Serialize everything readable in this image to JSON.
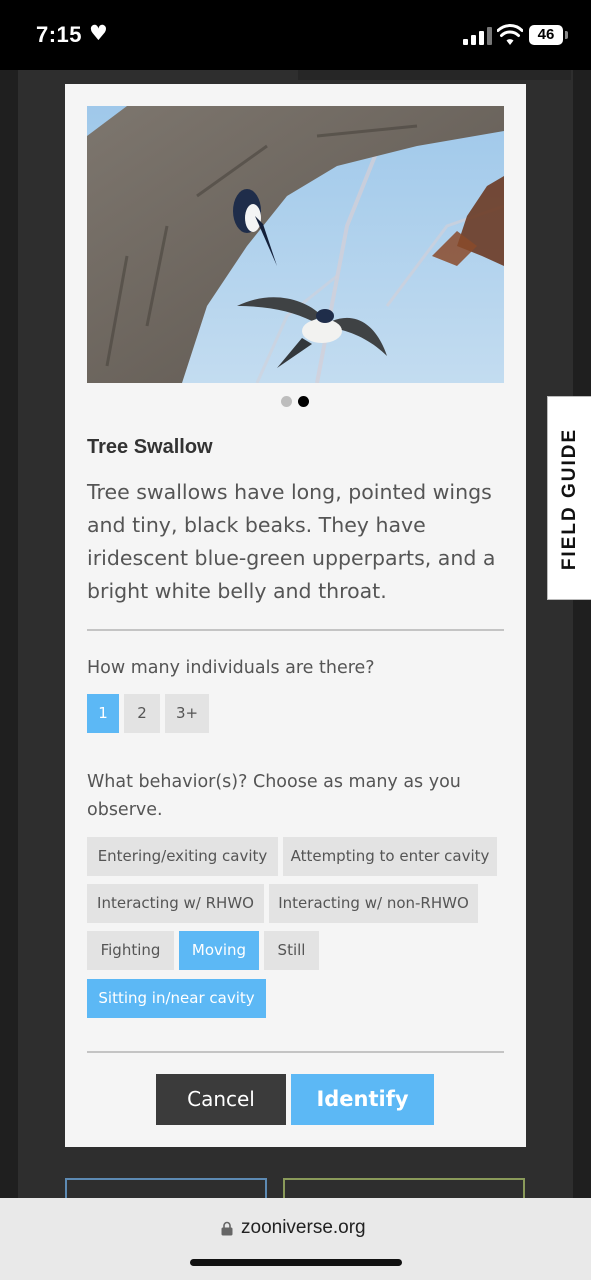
{
  "status_bar": {
    "time": "7:15",
    "battery": "46"
  },
  "modal": {
    "photo_icon": "tree-swallow-photo",
    "carousel": {
      "count": 2,
      "active_index": 1
    },
    "species_title": "Tree Swallow",
    "description": "Tree swallows have long, pointed wings and tiny, black beaks. They have iridescent blue-green upperparts, and a bright white belly and throat.",
    "question_count": "How many individuals are there?",
    "count_options": [
      {
        "label": "1",
        "selected": true
      },
      {
        "label": "2",
        "selected": false
      },
      {
        "label": "3+",
        "selected": false
      }
    ],
    "question_behavior": "What behavior(s)? Choose as many as you observe.",
    "behavior_options": [
      {
        "label": "Entering/exiting cavity",
        "selected": false
      },
      {
        "label": "Attempting to enter cavity",
        "selected": false
      },
      {
        "label": "Interacting w/ RHWO",
        "selected": false
      },
      {
        "label": "Interacting w/ non-RHWO",
        "selected": false
      },
      {
        "label": "Fighting",
        "selected": false
      },
      {
        "label": "Moving",
        "selected": true
      },
      {
        "label": "Still",
        "selected": false
      },
      {
        "label": "Sitting in/near cavity",
        "selected": true
      }
    ],
    "cancel_label": "Cancel",
    "identify_label": "Identify"
  },
  "field_guide_tab": "FIELD GUIDE",
  "browser": {
    "url": "zooniverse.org"
  },
  "colors": {
    "accent": "#5cb8f5",
    "chip": "#e3e3e3",
    "modal_bg": "#f5f5f5",
    "cancel_bg": "#3b3b3b"
  }
}
